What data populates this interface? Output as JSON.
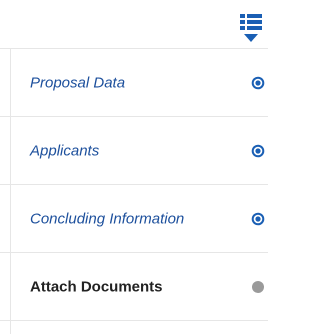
{
  "nav": {
    "items": [
      {
        "label": "Proposal Data",
        "state": "complete",
        "status_icon": "complete-target-icon"
      },
      {
        "label": "Applicants",
        "state": "complete",
        "status_icon": "complete-target-icon"
      },
      {
        "label": "Concluding Information",
        "state": "complete",
        "status_icon": "complete-target-icon"
      },
      {
        "label": "Attach Documents",
        "state": "current",
        "status_icon": "pending-dot-icon"
      }
    ]
  },
  "colors": {
    "link": "#1c4f9c",
    "accent": "#1a5fb4",
    "pending": "#9a9a9a",
    "current_text": "#222222"
  }
}
